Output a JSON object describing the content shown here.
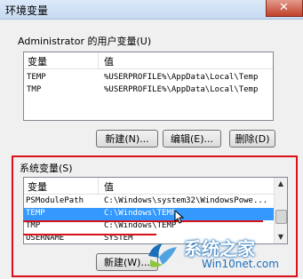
{
  "window": {
    "title": "环境变量",
    "close_glyph": "✕"
  },
  "user_vars": {
    "group_label": "Administrator 的用户变量(U)",
    "columns": [
      "变量",
      "值"
    ],
    "rows": [
      {
        "name": "TEMP",
        "value": "%USERPROFILE%\\AppData\\Local\\Temp"
      },
      {
        "name": "TMP",
        "value": "%USERPROFILE%\\AppData\\Local\\Temp"
      }
    ],
    "buttons": {
      "new": "新建(N)...",
      "edit": "编辑(E)...",
      "delete": "删除(D)"
    }
  },
  "system_vars": {
    "group_label": "系统变量(S)",
    "columns": [
      "变量",
      "值"
    ],
    "rows": [
      {
        "name": "PSModulePath",
        "value": "C:\\Windows\\system32\\WindowsPowe..."
      },
      {
        "name": "TEMP",
        "value": "C:\\Windows\\TEMP",
        "selected": true
      },
      {
        "name": "TMP",
        "value": "C:\\Windows\\TEMP"
      },
      {
        "name": "USERNAME",
        "value": "SYSTEM"
      }
    ],
    "buttons": {
      "new": "新建(W)..."
    }
  },
  "watermark": {
    "brand": "系统之家",
    "url": "Win10net.com"
  },
  "colors": {
    "highlight": "#3399ff",
    "annotation_red": "#d8101a",
    "brand_blue": "#1b6fb8"
  }
}
